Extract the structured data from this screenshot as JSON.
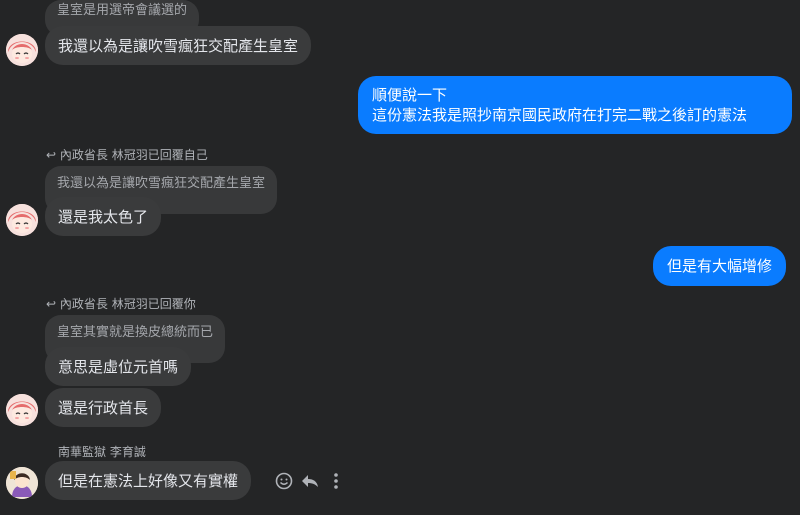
{
  "messages": {
    "m1_quote": "皇室是用選帝會議選的",
    "m1_text": "我還以為是讓吹雪瘋狂交配產生皇室",
    "m2_line1": "順便說一下",
    "m2_line2": "這份憲法我是照抄南京國民政府在打完二戰之後訂的憲法",
    "m3_reply_meta": "內政省長 林冠羽已回覆自己",
    "m3_quote": "我還以為是讓吹雪瘋狂交配產生皇室",
    "m3_text": "還是我太色了",
    "m4_text": "但是有大幅增修",
    "m5_reply_meta": "內政省長 林冠羽已回覆你",
    "m5_quote": "皇室其實就是換皮總統而已",
    "m5_text1": "意思是虛位元首嗎",
    "m5_text2": "還是行政首長",
    "m6_sender": "南華監獄 李育誠",
    "m6_text": "但是在憲法上好像又有實權"
  },
  "icons": {
    "reply": "reply-arrow-icon",
    "react": "smiley-face-icon",
    "more": "more-vertical-icon"
  },
  "colors": {
    "background": "#242526",
    "bubble_other": "#3a3b3c",
    "bubble_mine": "#0a7cff",
    "text_primary": "#e4e6eb",
    "text_secondary": "#b0b3b8"
  }
}
